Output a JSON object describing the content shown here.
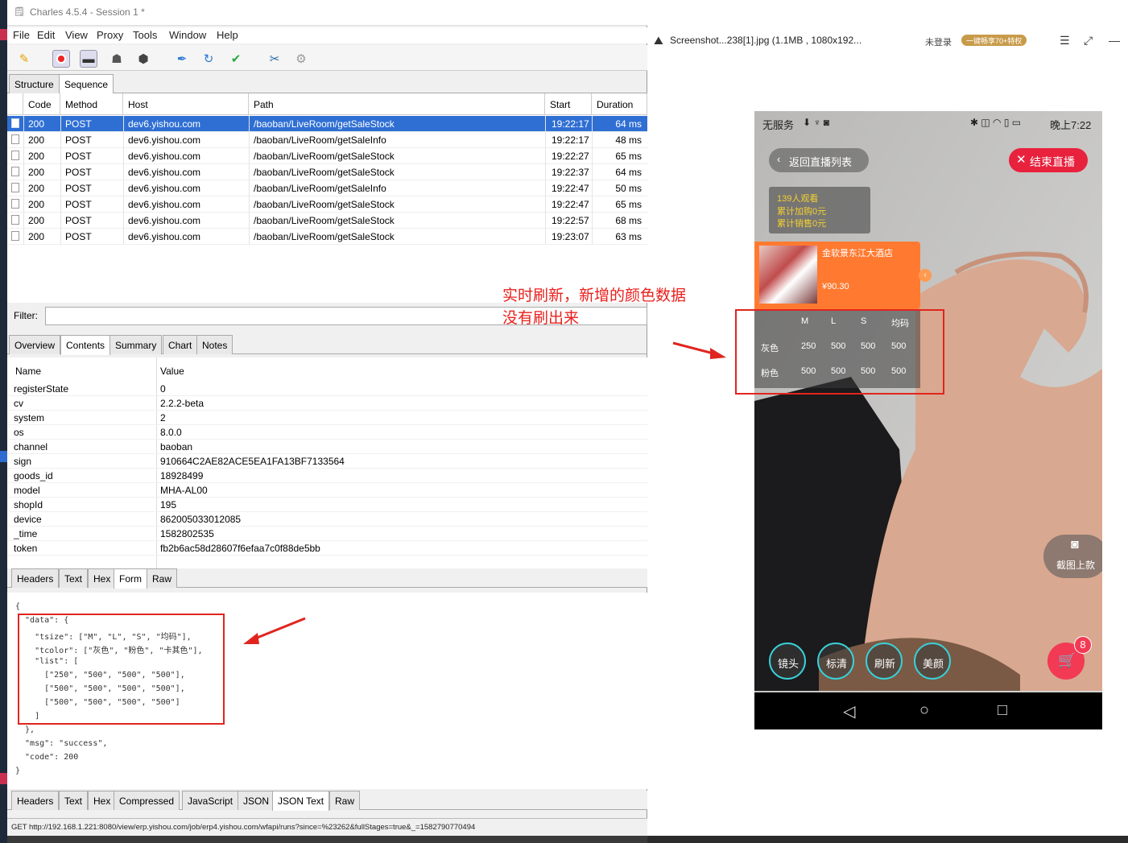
{
  "charles": {
    "title": "Charles 4.5.4 - Session 1 *",
    "menu": [
      "File",
      "Edit",
      "View",
      "Proxy",
      "Tools",
      "Window",
      "Help"
    ],
    "tabs_top": [
      "Structure",
      "Sequence"
    ],
    "columns": [
      "Code",
      "Method",
      "Host",
      "Path",
      "Start",
      "Duration"
    ],
    "rows": [
      {
        "code": "200",
        "method": "POST",
        "host": "dev6.yishou.com",
        "path": "/baoban/LiveRoom/getSaleStock",
        "start": "19:22:17",
        "duration": "64 ms"
      },
      {
        "code": "200",
        "method": "POST",
        "host": "dev6.yishou.com",
        "path": "/baoban/LiveRoom/getSaleInfo",
        "start": "19:22:17",
        "duration": "48 ms"
      },
      {
        "code": "200",
        "method": "POST",
        "host": "dev6.yishou.com",
        "path": "/baoban/LiveRoom/getSaleStock",
        "start": "19:22:27",
        "duration": "65 ms"
      },
      {
        "code": "200",
        "method": "POST",
        "host": "dev6.yishou.com",
        "path": "/baoban/LiveRoom/getSaleStock",
        "start": "19:22:37",
        "duration": "64 ms"
      },
      {
        "code": "200",
        "method": "POST",
        "host": "dev6.yishou.com",
        "path": "/baoban/LiveRoom/getSaleInfo",
        "start": "19:22:47",
        "duration": "50 ms"
      },
      {
        "code": "200",
        "method": "POST",
        "host": "dev6.yishou.com",
        "path": "/baoban/LiveRoom/getSaleStock",
        "start": "19:22:47",
        "duration": "65 ms"
      },
      {
        "code": "200",
        "method": "POST",
        "host": "dev6.yishou.com",
        "path": "/baoban/LiveRoom/getSaleStock",
        "start": "19:22:57",
        "duration": "68 ms"
      },
      {
        "code": "200",
        "method": "POST",
        "host": "dev6.yishou.com",
        "path": "/baoban/LiveRoom/getSaleStock",
        "start": "19:23:07",
        "duration": "63 ms"
      }
    ],
    "filter_label": "Filter:",
    "detail_tabs": [
      "Overview",
      "Contents",
      "Summary",
      "Chart",
      "Notes"
    ],
    "nv_headers": [
      "Name",
      "Value"
    ],
    "nv_rows": [
      {
        "name": "registerState",
        "value": "0"
      },
      {
        "name": "cv",
        "value": "2.2.2-beta"
      },
      {
        "name": "system",
        "value": "2"
      },
      {
        "name": "os",
        "value": "8.0.0"
      },
      {
        "name": "channel",
        "value": "baoban"
      },
      {
        "name": "sign",
        "value": "910664C2AE82ACE5EA1FA13BF7133564"
      },
      {
        "name": "goods_id",
        "value": "18928499"
      },
      {
        "name": "model",
        "value": "MHA-AL00"
      },
      {
        "name": "shopId",
        "value": "195"
      },
      {
        "name": "device",
        "value": "862005033012085"
      },
      {
        "name": "_time",
        "value": "1582802535"
      },
      {
        "name": "token",
        "value": "fb2b6ac58d28607f6efaa7c0f88de5bb"
      }
    ],
    "req_tabs": [
      "Headers",
      "Text",
      "Hex",
      "Form",
      "Raw"
    ],
    "json_lines": [
      "{",
      "  \"data\": {",
      "    \"tsize\": [\"M\", \"L\", \"S\", \"均码\"],",
      "    \"tcolor\": [\"灰色\", \"粉色\", \"卡其色\"],",
      "    \"list\": [",
      "      [\"250\", \"500\", \"500\", \"500\"],",
      "      [\"500\", \"500\", \"500\", \"500\"],",
      "      [\"500\", \"500\", \"500\", \"500\"]",
      "    ]",
      "  },",
      "  \"msg\": \"success\",",
      "  \"code\": 200",
      "}"
    ],
    "resp_tabs": [
      "Headers",
      "Text",
      "Hex",
      "Compressed",
      "JavaScript",
      "JSON",
      "JSON Text",
      "Raw"
    ],
    "status_url": "GET http://192.168.1.221:8080/view/erp.yishou.com/job/erp4.yishou.com/wfapi/runs?since=%23262&fullStages=true&_=1582790770494"
  },
  "viewer": {
    "filename": "Screenshot...238[1].jpg (1.1MB , 1080x192...",
    "login": "未登录",
    "promo": "一键畅享70+特权"
  },
  "phone": {
    "status_left": "无服务",
    "status_time": "晚上7:22",
    "back_btn": "返回直播列表",
    "end_btn": "结束直播",
    "viewers": "139人观看",
    "cart_total": "累计加购0元",
    "sales_total": "累计销售0元",
    "product_name": "金软景东江大酒店",
    "product_price": "¥90.30",
    "sizes": [
      "M",
      "L",
      "S",
      "均码"
    ],
    "colors": [
      {
        "name": "灰色",
        "values": [
          "250",
          "500",
          "500",
          "500"
        ]
      },
      {
        "name": "粉色",
        "values": [
          "500",
          "500",
          "500",
          "500"
        ]
      }
    ],
    "screenshot_btn": "截图上款",
    "bottom_btns": [
      "镜头",
      "标清",
      "刷新",
      "美颜"
    ],
    "cart_badge": "8"
  },
  "annotation": {
    "line1": "实时刷新，新增的颜色数据",
    "line2": "没有刷出来"
  },
  "colors": {
    "selection": "#2f6fd4",
    "annotation": "#e0251e",
    "endLive": "#e8213d",
    "product": "#ff7a30"
  }
}
